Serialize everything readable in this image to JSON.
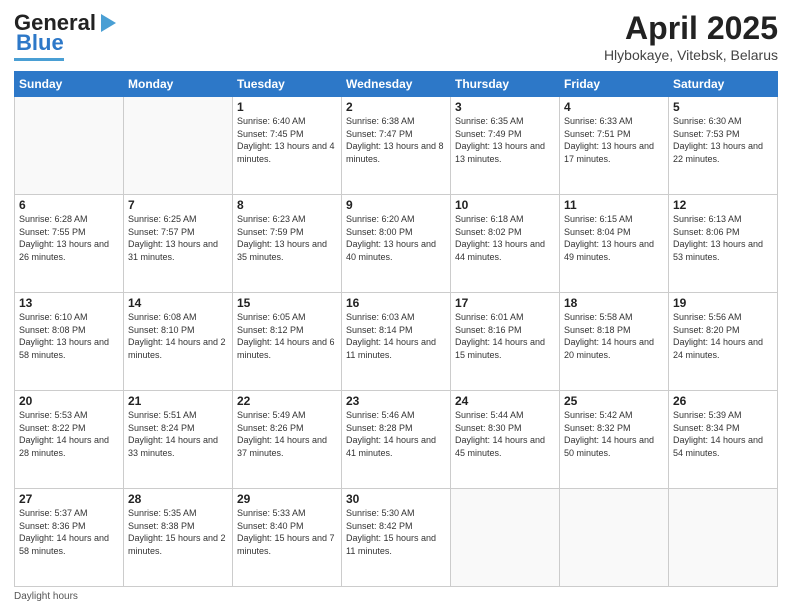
{
  "header": {
    "logo_general": "General",
    "logo_blue": "Blue",
    "month_title": "April 2025",
    "location": "Hlybokaye, Vitebsk, Belarus"
  },
  "weekdays": [
    "Sunday",
    "Monday",
    "Tuesday",
    "Wednesday",
    "Thursday",
    "Friday",
    "Saturday"
  ],
  "footer": {
    "daylight_label": "Daylight hours"
  },
  "days": [
    {
      "num": "",
      "sunrise": "",
      "sunset": "",
      "daylight": ""
    },
    {
      "num": "",
      "sunrise": "",
      "sunset": "",
      "daylight": ""
    },
    {
      "num": "1",
      "sunrise": "Sunrise: 6:40 AM",
      "sunset": "Sunset: 7:45 PM",
      "daylight": "Daylight: 13 hours and 4 minutes."
    },
    {
      "num": "2",
      "sunrise": "Sunrise: 6:38 AM",
      "sunset": "Sunset: 7:47 PM",
      "daylight": "Daylight: 13 hours and 8 minutes."
    },
    {
      "num": "3",
      "sunrise": "Sunrise: 6:35 AM",
      "sunset": "Sunset: 7:49 PM",
      "daylight": "Daylight: 13 hours and 13 minutes."
    },
    {
      "num": "4",
      "sunrise": "Sunrise: 6:33 AM",
      "sunset": "Sunset: 7:51 PM",
      "daylight": "Daylight: 13 hours and 17 minutes."
    },
    {
      "num": "5",
      "sunrise": "Sunrise: 6:30 AM",
      "sunset": "Sunset: 7:53 PM",
      "daylight": "Daylight: 13 hours and 22 minutes."
    },
    {
      "num": "6",
      "sunrise": "Sunrise: 6:28 AM",
      "sunset": "Sunset: 7:55 PM",
      "daylight": "Daylight: 13 hours and 26 minutes."
    },
    {
      "num": "7",
      "sunrise": "Sunrise: 6:25 AM",
      "sunset": "Sunset: 7:57 PM",
      "daylight": "Daylight: 13 hours and 31 minutes."
    },
    {
      "num": "8",
      "sunrise": "Sunrise: 6:23 AM",
      "sunset": "Sunset: 7:59 PM",
      "daylight": "Daylight: 13 hours and 35 minutes."
    },
    {
      "num": "9",
      "sunrise": "Sunrise: 6:20 AM",
      "sunset": "Sunset: 8:00 PM",
      "daylight": "Daylight: 13 hours and 40 minutes."
    },
    {
      "num": "10",
      "sunrise": "Sunrise: 6:18 AM",
      "sunset": "Sunset: 8:02 PM",
      "daylight": "Daylight: 13 hours and 44 minutes."
    },
    {
      "num": "11",
      "sunrise": "Sunrise: 6:15 AM",
      "sunset": "Sunset: 8:04 PM",
      "daylight": "Daylight: 13 hours and 49 minutes."
    },
    {
      "num": "12",
      "sunrise": "Sunrise: 6:13 AM",
      "sunset": "Sunset: 8:06 PM",
      "daylight": "Daylight: 13 hours and 53 minutes."
    },
    {
      "num": "13",
      "sunrise": "Sunrise: 6:10 AM",
      "sunset": "Sunset: 8:08 PM",
      "daylight": "Daylight: 13 hours and 58 minutes."
    },
    {
      "num": "14",
      "sunrise": "Sunrise: 6:08 AM",
      "sunset": "Sunset: 8:10 PM",
      "daylight": "Daylight: 14 hours and 2 minutes."
    },
    {
      "num": "15",
      "sunrise": "Sunrise: 6:05 AM",
      "sunset": "Sunset: 8:12 PM",
      "daylight": "Daylight: 14 hours and 6 minutes."
    },
    {
      "num": "16",
      "sunrise": "Sunrise: 6:03 AM",
      "sunset": "Sunset: 8:14 PM",
      "daylight": "Daylight: 14 hours and 11 minutes."
    },
    {
      "num": "17",
      "sunrise": "Sunrise: 6:01 AM",
      "sunset": "Sunset: 8:16 PM",
      "daylight": "Daylight: 14 hours and 15 minutes."
    },
    {
      "num": "18",
      "sunrise": "Sunrise: 5:58 AM",
      "sunset": "Sunset: 8:18 PM",
      "daylight": "Daylight: 14 hours and 20 minutes."
    },
    {
      "num": "19",
      "sunrise": "Sunrise: 5:56 AM",
      "sunset": "Sunset: 8:20 PM",
      "daylight": "Daylight: 14 hours and 24 minutes."
    },
    {
      "num": "20",
      "sunrise": "Sunrise: 5:53 AM",
      "sunset": "Sunset: 8:22 PM",
      "daylight": "Daylight: 14 hours and 28 minutes."
    },
    {
      "num": "21",
      "sunrise": "Sunrise: 5:51 AM",
      "sunset": "Sunset: 8:24 PM",
      "daylight": "Daylight: 14 hours and 33 minutes."
    },
    {
      "num": "22",
      "sunrise": "Sunrise: 5:49 AM",
      "sunset": "Sunset: 8:26 PM",
      "daylight": "Daylight: 14 hours and 37 minutes."
    },
    {
      "num": "23",
      "sunrise": "Sunrise: 5:46 AM",
      "sunset": "Sunset: 8:28 PM",
      "daylight": "Daylight: 14 hours and 41 minutes."
    },
    {
      "num": "24",
      "sunrise": "Sunrise: 5:44 AM",
      "sunset": "Sunset: 8:30 PM",
      "daylight": "Daylight: 14 hours and 45 minutes."
    },
    {
      "num": "25",
      "sunrise": "Sunrise: 5:42 AM",
      "sunset": "Sunset: 8:32 PM",
      "daylight": "Daylight: 14 hours and 50 minutes."
    },
    {
      "num": "26",
      "sunrise": "Sunrise: 5:39 AM",
      "sunset": "Sunset: 8:34 PM",
      "daylight": "Daylight: 14 hours and 54 minutes."
    },
    {
      "num": "27",
      "sunrise": "Sunrise: 5:37 AM",
      "sunset": "Sunset: 8:36 PM",
      "daylight": "Daylight: 14 hours and 58 minutes."
    },
    {
      "num": "28",
      "sunrise": "Sunrise: 5:35 AM",
      "sunset": "Sunset: 8:38 PM",
      "daylight": "Daylight: 15 hours and 2 minutes."
    },
    {
      "num": "29",
      "sunrise": "Sunrise: 5:33 AM",
      "sunset": "Sunset: 8:40 PM",
      "daylight": "Daylight: 15 hours and 7 minutes."
    },
    {
      "num": "30",
      "sunrise": "Sunrise: 5:30 AM",
      "sunset": "Sunset: 8:42 PM",
      "daylight": "Daylight: 15 hours and 11 minutes."
    },
    {
      "num": "",
      "sunrise": "",
      "sunset": "",
      "daylight": ""
    },
    {
      "num": "",
      "sunrise": "",
      "sunset": "",
      "daylight": ""
    },
    {
      "num": "",
      "sunrise": "",
      "sunset": "",
      "daylight": ""
    }
  ]
}
